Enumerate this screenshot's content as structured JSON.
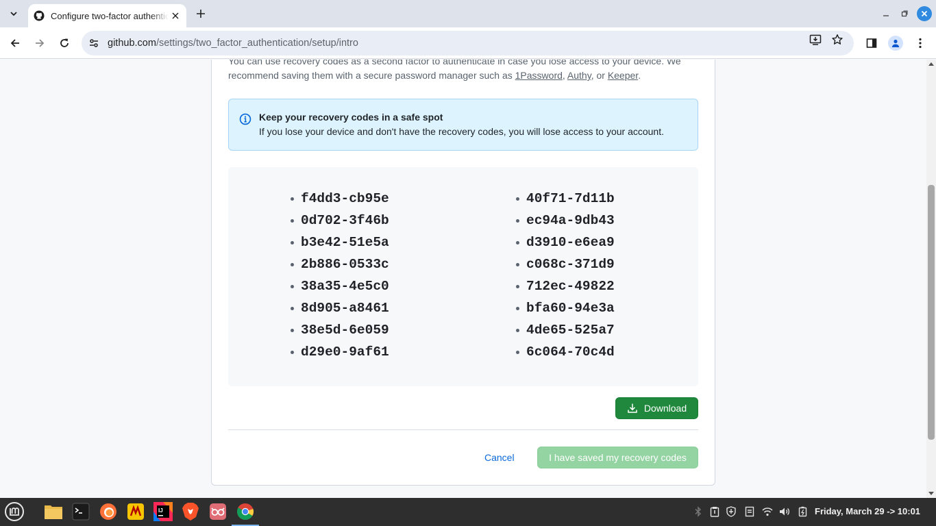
{
  "browser": {
    "tab_title": "Configure two-factor authentication",
    "url_host": "github.com",
    "url_path": "/settings/two_factor_authentication/setup/intro"
  },
  "page": {
    "intro_line1": "You can use recovery codes as a second factor to authenticate in case you lose access to your device. We",
    "intro_line2_prefix": "recommend saving them with a secure password manager such as ",
    "links": [
      "1Password",
      "Authy",
      "Keeper"
    ],
    "sep_comma": ", ",
    "sep_or": ", or ",
    "period": ".",
    "flash_title": "Keep your recovery codes in a safe spot",
    "flash_body": "If you lose your device and don't have the recovery codes, you will lose access to your account.",
    "codes_left": [
      "f4dd3-cb95e",
      "0d702-3f46b",
      "b3e42-51e5a",
      "2b886-0533c",
      "38a35-4e5c0",
      "8d905-a8461",
      "38e5d-6e059",
      "d29e0-9af61"
    ],
    "codes_right": [
      "40f71-7d11b",
      "ec94a-9db43",
      "d3910-e6ea9",
      "c068c-371d9",
      "712ec-49822",
      "bfa60-94e3a",
      "4de65-525a7",
      "6c064-70c4d"
    ],
    "download_label": "Download",
    "cancel_label": "Cancel",
    "saved_label": "I have saved my recovery codes"
  },
  "taskbar": {
    "clock": "Friday, March 29 -> 10:01",
    "apps": [
      "menu-icon",
      "files-icon",
      "terminal-icon",
      "firefox-icon",
      "filezilla-icon",
      "intellij-icon",
      "brave-icon",
      "readers-icon",
      "chrome-icon"
    ]
  },
  "colors": {
    "primary_green": "#1f883d",
    "disabled_green": "#94d3a2",
    "link_blue": "#0969da",
    "flash_bg": "#ddf4ff"
  }
}
